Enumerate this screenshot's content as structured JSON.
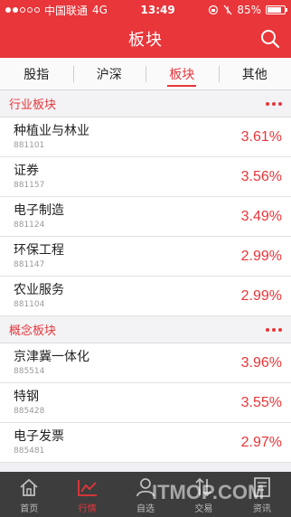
{
  "status_bar": {
    "carrier": "中国联通",
    "network": "4G",
    "time": "13:49",
    "battery": "85%",
    "battery_level": 0.85
  },
  "header": {
    "title": "板块",
    "search_icon": "search-icon"
  },
  "tabs": [
    {
      "label": "股指",
      "active": false
    },
    {
      "label": "沪深",
      "active": false
    },
    {
      "label": "板块",
      "active": true
    },
    {
      "label": "其他",
      "active": false
    }
  ],
  "sections": [
    {
      "title": "行业板块",
      "rows": [
        {
          "name": "种植业与林业",
          "code": "881101",
          "change": "3.61%"
        },
        {
          "name": "证券",
          "code": "881157",
          "change": "3.56%"
        },
        {
          "name": "电子制造",
          "code": "881124",
          "change": "3.49%"
        },
        {
          "name": "环保工程",
          "code": "881147",
          "change": "2.99%"
        },
        {
          "name": "农业服务",
          "code": "881104",
          "change": "2.99%"
        }
      ]
    },
    {
      "title": "概念板块",
      "rows": [
        {
          "name": "京津冀一体化",
          "code": "885514",
          "change": "3.96%"
        },
        {
          "name": "特钢",
          "code": "885428",
          "change": "3.55%"
        },
        {
          "name": "电子发票",
          "code": "885481",
          "change": "2.97%"
        }
      ]
    }
  ],
  "tabbar": [
    {
      "label": "首页",
      "icon": "home-icon",
      "active": false
    },
    {
      "label": "行情",
      "icon": "chart-icon",
      "active": true
    },
    {
      "label": "自选",
      "icon": "person-icon",
      "active": false
    },
    {
      "label": "交易",
      "icon": "transfer-icon",
      "active": false
    },
    {
      "label": "资讯",
      "icon": "news-icon",
      "active": false
    }
  ],
  "colors": {
    "accent": "#e8363a",
    "tabbar_bg": "#3d3d3d"
  },
  "watermark": "ITMOP.COM"
}
